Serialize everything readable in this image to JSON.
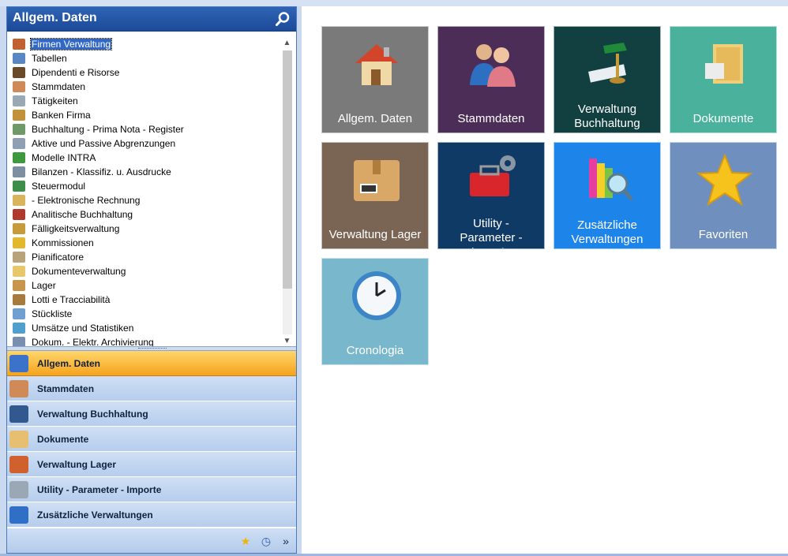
{
  "nav": {
    "title": "Allgem. Daten",
    "tree_items": [
      {
        "label": "Firmen Verwaltung",
        "icon": "house-icon",
        "color": "#c0612f",
        "selected": true
      },
      {
        "label": "Tabellen",
        "icon": "table-icon",
        "color": "#5b86c4"
      },
      {
        "label": "Dipendenti e Risorse",
        "icon": "forklift-icon",
        "color": "#6b4a2a"
      },
      {
        "label": "Stammdaten",
        "icon": "people-icon",
        "color": "#d08a58"
      },
      {
        "label": "Tätigkeiten",
        "icon": "calendar-icon",
        "color": "#9aa7b5"
      },
      {
        "label": "Banken Firma",
        "icon": "bank-icon",
        "color": "#c2913a"
      },
      {
        "label": "Buchhaltung - Prima Nota - Register",
        "icon": "ledger-icon",
        "color": "#6e9a6a"
      },
      {
        "label": "Aktive und Passive Abgrenzungen",
        "icon": "calculator-icon",
        "color": "#8fa0b4"
      },
      {
        "label": "Modelle INTRA",
        "icon": "book-icon",
        "color": "#3f9a3f"
      },
      {
        "label": "Bilanzen - Klassifiz. u. Ausdrucke",
        "icon": "balance-icon",
        "color": "#7f8fa2"
      },
      {
        "label": "Steuermodul",
        "icon": "tax-icon",
        "color": "#3e8e4a"
      },
      {
        "label": " - Elektronische Rechnung",
        "icon": "invoice-icon",
        "color": "#d9b45a"
      },
      {
        "label": "Analitische Buchhaltung",
        "icon": "chart-book-icon",
        "color": "#b03a2e"
      },
      {
        "label": "Fälligkeitsverwaltung",
        "icon": "folder-clock-icon",
        "color": "#c79a3a"
      },
      {
        "label": "Kommissionen",
        "icon": "key-icon",
        "color": "#e3b82c"
      },
      {
        "label": "Pianificatore",
        "icon": "planner-icon",
        "color": "#b9a37a"
      },
      {
        "label": "Dokumenteverwaltung",
        "icon": "document-icon",
        "color": "#e8c66a"
      },
      {
        "label": "Lager",
        "icon": "box-icon",
        "color": "#c8954a"
      },
      {
        "label": "Lotti e Tracciabilità",
        "icon": "boxes-icon",
        "color": "#a77a3d"
      },
      {
        "label": "Stückliste",
        "icon": "parts-list-icon",
        "color": "#6f9fd0"
      },
      {
        "label": "Umsätze und Statistiken",
        "icon": "statistics-icon",
        "color": "#4f9fcf"
      },
      {
        "label": "Dokum. - Elektr. Archivierung",
        "icon": "archive-icon",
        "color": "#7a8fb0"
      }
    ],
    "sections": [
      {
        "label": "Allgem. Daten",
        "icon": "cubes-icon",
        "color": "#3a73c9",
        "active": true
      },
      {
        "label": "Stammdaten",
        "icon": "people-icon",
        "color": "#d08a58"
      },
      {
        "label": "Verwaltung Buchhaltung",
        "icon": "ledger-icon",
        "color": "#31598f"
      },
      {
        "label": "Dokumente",
        "icon": "folder-icon",
        "color": "#e6c070"
      },
      {
        "label": "Verwaltung Lager",
        "icon": "box-icon",
        "color": "#d0612f"
      },
      {
        "label": "Utility  - Parameter - Importe",
        "icon": "tools-icon",
        "color": "#9aa7b5"
      },
      {
        "label": "Zusätzliche Verwaltungen",
        "icon": "cube-icon",
        "color": "#2f6fc6"
      }
    ],
    "footer": [
      {
        "icon": "star-icon",
        "glyph": "★",
        "color": "#f0b400"
      },
      {
        "icon": "clock-icon",
        "glyph": "◷",
        "color": "#2f5fa8"
      },
      {
        "icon": "chevron-more-icon",
        "glyph": "»",
        "color": "#1a2a44"
      }
    ]
  },
  "tiles": [
    {
      "label": "Allgem. Daten",
      "bg": "#7a7a7a",
      "icon": "house-icon"
    },
    {
      "label": "Stammdaten",
      "bg": "#4c2d57",
      "icon": "people-icon"
    },
    {
      "label": "Verwaltung\nBuchhaltung",
      "bg": "#123f3f",
      "icon": "desk-lamp-icon"
    },
    {
      "label": "Dokumente",
      "bg": "#4ab19c",
      "icon": "folder-icon"
    },
    {
      "label": "Verwaltung Lager",
      "bg": "#7a6454",
      "icon": "package-icon"
    },
    {
      "label": "Utility  -\nParameter -\nImporte",
      "bg": "#0f3a65",
      "icon": "toolbox-icon"
    },
    {
      "label": "Zusätzliche\nVerwaltungen",
      "bg": "#1d84ea",
      "icon": "books-magnifier-icon"
    },
    {
      "label": "Favoriten",
      "bg": "#6f8fbf",
      "icon": "star-icon"
    },
    {
      "label": "Cronologia",
      "bg": "#79b7cc",
      "icon": "clock-icon"
    }
  ]
}
